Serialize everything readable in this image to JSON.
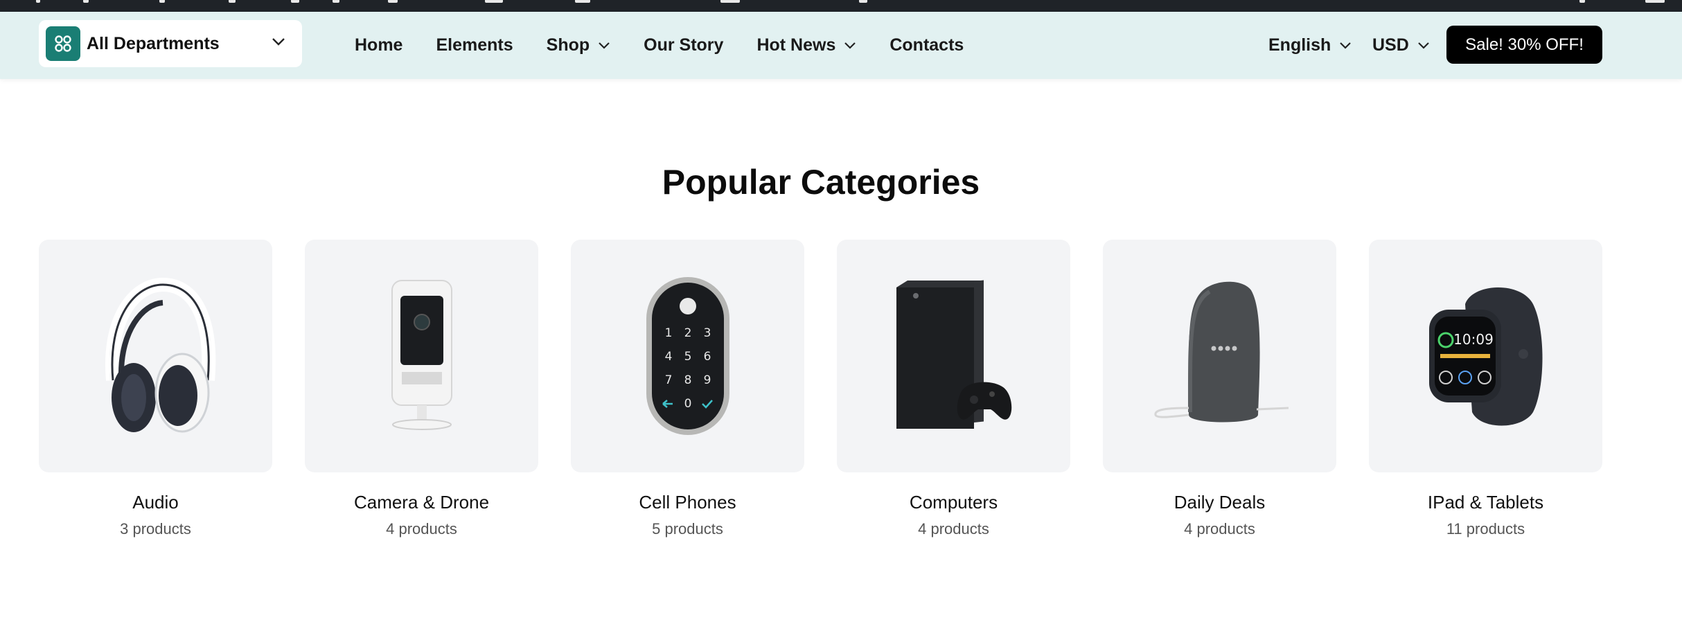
{
  "header": {
    "department_label": "All Departments",
    "nav": [
      {
        "label": "Home",
        "has_dropdown": false
      },
      {
        "label": "Elements",
        "has_dropdown": false
      },
      {
        "label": "Shop",
        "has_dropdown": true
      },
      {
        "label": "Our Story",
        "has_dropdown": false
      },
      {
        "label": "Hot News",
        "has_dropdown": true
      },
      {
        "label": "Contacts",
        "has_dropdown": false
      }
    ],
    "language": "English",
    "currency": "USD",
    "sale_label": "Sale! 30% OFF!"
  },
  "section_title": "Popular Categories",
  "categories": [
    {
      "name": "Audio",
      "count": "3 products",
      "icon": "headphones-icon"
    },
    {
      "name": "Camera & Drone",
      "count": "4 products",
      "icon": "security-camera-icon"
    },
    {
      "name": "Cell Phones",
      "count": "5 products",
      "icon": "smart-lock-keypad-icon"
    },
    {
      "name": "Computers",
      "count": "4 products",
      "icon": "game-console-icon"
    },
    {
      "name": "Daily Deals",
      "count": "4 products",
      "icon": "smart-speaker-icon"
    },
    {
      "name": "IPad & Tablets",
      "count": "11 products",
      "icon": "smartwatch-icon"
    }
  ],
  "colors": {
    "header_bg": "#e2f1f1",
    "brand_teal": "#1a7e74",
    "sale_bg": "#000000",
    "card_bg": "#f3f4f6"
  }
}
